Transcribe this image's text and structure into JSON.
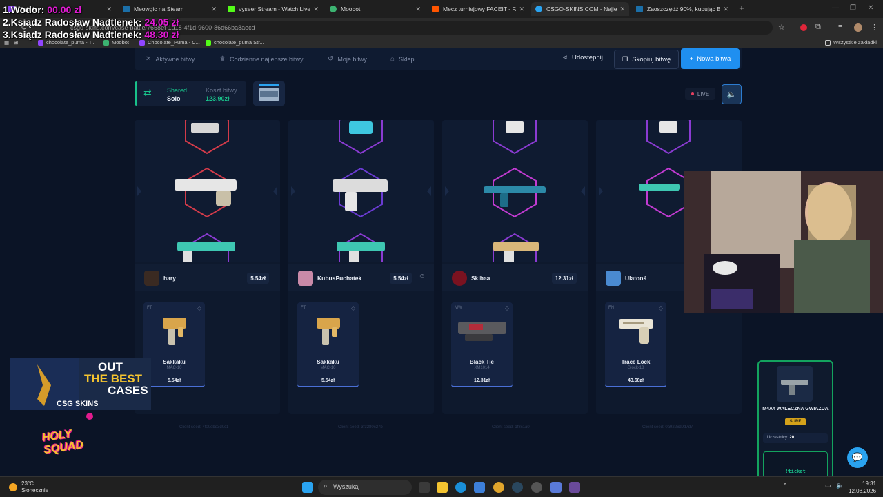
{
  "browser": {
    "tabs": [
      {
        "label": "Twitch",
        "active": false
      },
      {
        "label": "Meowgic na Steam",
        "active": false
      },
      {
        "label": "vyseer Stream - Watch Live on",
        "active": false
      },
      {
        "label": "Moobot",
        "active": false
      },
      {
        "label": "Mecz turniejowy FACEIT - FACE",
        "active": false
      },
      {
        "label": "CSGO-SKINS.COM - Najlepsze",
        "active": true
      },
      {
        "label": "Zaoszczędź 90%, kupując Black",
        "active": false
      }
    ],
    "url": "csgo-skins.com/case-battle/7658ef-1d18-4f1d-9600-86d66ba8aecd",
    "bookmarks": [
      "chocolate_puma - T...",
      "Moobot",
      "Chocolate_Puma - C...",
      "chocolate_puma Str..."
    ],
    "all_bookmarks": "Wszystkie zakładki"
  },
  "overlay": {
    "ranking": [
      {
        "label": "1.Wodor:",
        "value": "00.00 zł"
      },
      {
        "label": "2.Ksiądz Radosław Nadtlenek:",
        "value": "24.05 zł"
      },
      {
        "label": "3.Ksiądz Radosław Nadtlenek:",
        "value": "48.30 zł"
      }
    ]
  },
  "nav": {
    "active_battles": "Aktywne bitwy",
    "daily_best": "Codzienne najlepsze bitwy",
    "my_battles": "Moje bitwy",
    "shop": "Sklep",
    "share": "Udostępnij",
    "copy_battle": "Skopiuj bitwę",
    "new_battle": "Nowa bitwa"
  },
  "battle": {
    "mode": "Shared",
    "mode_sub": "Solo",
    "cost_label": "Koszt bitwy",
    "cost_value": "123.90zł",
    "live": "LIVE",
    "accent_color": "#19c18a"
  },
  "players": [
    {
      "name": "hary",
      "total": "5.54zł",
      "item": {
        "cond": "FT",
        "name": "Sakkaku",
        "weapon": "MAC-10",
        "price": "5.54zł"
      },
      "seed": "Client seed: 4f00ebd3d0c1"
    },
    {
      "name": "KubusPuchatek",
      "total": "5.54zł",
      "item": {
        "cond": "FT",
        "name": "Sakkaku",
        "weapon": "MAC-10",
        "price": "5.54zł"
      },
      "seed": "Client seed: 3f3280c27b"
    },
    {
      "name": "Skibaa",
      "total": "12.31zł",
      "item": {
        "cond": "MW",
        "name": "Black Tie",
        "weapon": "XM1014",
        "price": "12.31zł"
      },
      "seed": "Client seed: 1f8c1a0"
    },
    {
      "name": "Ulatooś",
      "total": "",
      "item": {
        "cond": "FN",
        "name": "Trace Lock",
        "weapon": "Glock-18",
        "price": "43.68zł"
      },
      "seed": "Client seed: 0a9226d9d7d7"
    }
  ],
  "promo": {
    "line1": "OUT",
    "line2": "THE BEST",
    "line3": "CASES",
    "brand": "CSG SKINS",
    "holy": "HOLY SQUAD"
  },
  "widget": {
    "title": "M4A4 WALECZNA GWIAZDA",
    "badge": "SURE",
    "participants_label": "Uczestnicy:",
    "participants": "20",
    "cta": "!ticket"
  },
  "taskbar": {
    "temp": "23°C",
    "weather": "Słonecznie",
    "search": "Wyszukaj",
    "time": "19:31",
    "date": "12.08.2026"
  }
}
